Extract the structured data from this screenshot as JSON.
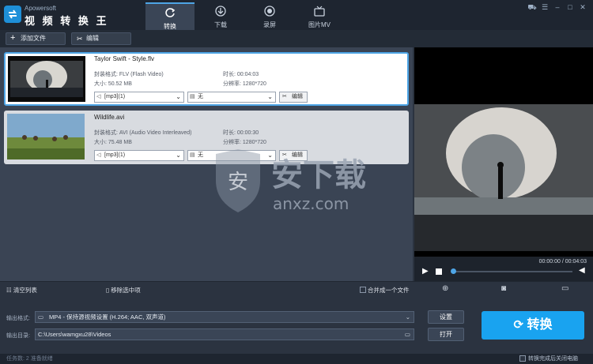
{
  "app": {
    "brand": "Apowersoft",
    "title": "视 频 转 换 王"
  },
  "nav": [
    {
      "label": "转换",
      "icon": "refresh-icon",
      "active": true
    },
    {
      "label": "下载",
      "icon": "download-icon",
      "active": false
    },
    {
      "label": "录屏",
      "icon": "record-icon",
      "active": false
    },
    {
      "label": "图片MV",
      "icon": "tv-icon",
      "active": false
    }
  ],
  "toolbar": {
    "add_file": "添加文件",
    "edit": "编辑"
  },
  "files": [
    {
      "name": "Taylor Swift - Style.flv",
      "format_label": "封装格式:",
      "format": "FLV (Flash Video)",
      "duration_label": "时长:",
      "duration": "00:04:03",
      "size_label": "大小:",
      "size": "50.52 MB",
      "resolution_label": "分辨率:",
      "resolution": "1280*720",
      "audio": "[mp3](1)",
      "subtitle": "无",
      "edit": "编辑"
    },
    {
      "name": "Wildlife.avi",
      "format_label": "封装格式:",
      "format": "AVI (Audio Video Interleaved)",
      "duration_label": "时长:",
      "duration": "00:00:30",
      "size_label": "大小:",
      "size": "75.48 MB",
      "resolution_label": "分辨率:",
      "resolution": "1280*720",
      "audio": "[mp3](1)",
      "subtitle": "无",
      "edit": "编辑"
    }
  ],
  "player": {
    "time": "00:00:00 / 00:04:03",
    "progress": 0.0
  },
  "listbar": {
    "clear": "清空列表",
    "remove": "移除选中项",
    "merge": "合并成一个文件"
  },
  "output": {
    "format_label": "输出格式:",
    "format_value": "MP4 - 保持源视频设置 (H.264; AAC, 双声道)",
    "dir_label": "输出目录:",
    "dir_value": "C:\\Users\\wamgxu28\\Videos",
    "settings": "设置",
    "open": "打开"
  },
  "convert": {
    "label": "转换"
  },
  "status": {
    "left": "任务数: 2    准备就绪",
    "shutdown": "转换完成后关闭电脑"
  },
  "watermark": {
    "text": "安下载",
    "sub": "anxz.com",
    "shield_char": "安"
  },
  "colors": {
    "accent": "#19a3f0",
    "selection": "#4ea5e6"
  }
}
